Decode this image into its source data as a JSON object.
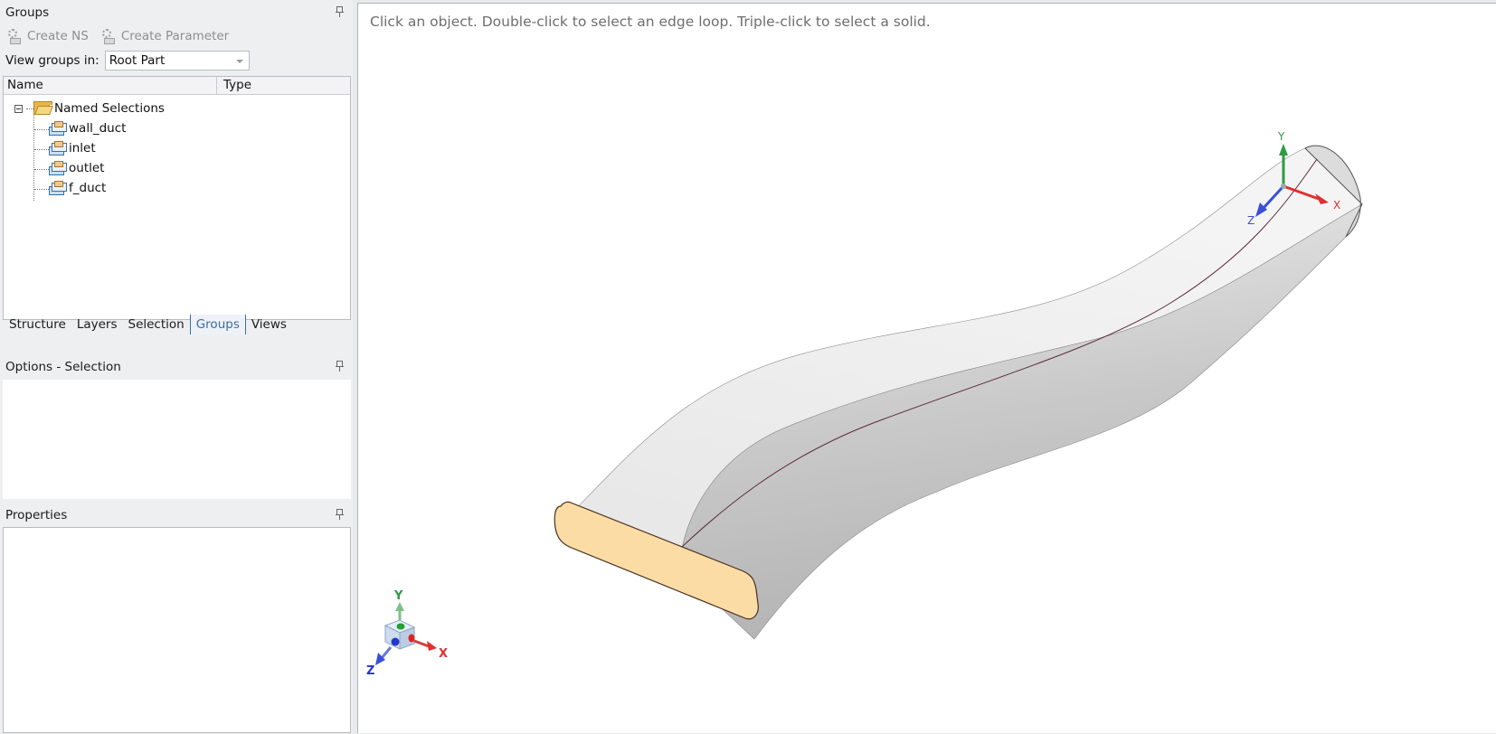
{
  "groups_panel": {
    "title": "Groups",
    "toolbar": {
      "create_ns": "Create NS",
      "create_parameter": "Create Parameter"
    },
    "view_groups_label": "View groups in:",
    "view_groups_value": "Root Part",
    "columns": {
      "name": "Name",
      "type": "Type"
    },
    "tree": {
      "folder": "Named Selections",
      "items": [
        {
          "label": "wall_duct"
        },
        {
          "label": "inlet"
        },
        {
          "label": "outlet"
        },
        {
          "label": "f_duct"
        }
      ]
    },
    "tabs": [
      "Structure",
      "Layers",
      "Selection",
      "Groups",
      "Views"
    ],
    "active_tab": "Groups"
  },
  "options_panel": {
    "title": "Options - Selection"
  },
  "properties_panel": {
    "title": "Properties"
  },
  "viewport": {
    "hint": "Click an object. Double-click to select an edge loop. Triple-click to select a solid.",
    "triad_labels": {
      "x": "X",
      "y": "Y",
      "z": "Z"
    },
    "colors": {
      "inlet_face": "#fcdca5",
      "duct_body": "#d9d9d9",
      "axis_x": "#e03030",
      "axis_y": "#2f9a45",
      "axis_z": "#3a4fd8"
    }
  }
}
